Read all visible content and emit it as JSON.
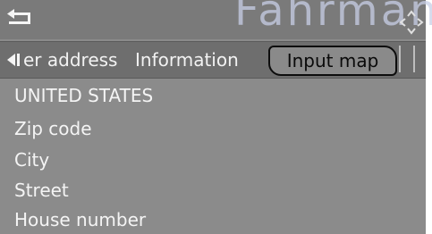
{
  "watermark": "Fahrmanual",
  "tabs": {
    "previous_label": "er address",
    "info_label": "Information",
    "active_label": "Input map"
  },
  "list": {
    "items": [
      {
        "label": "UNITED STATES"
      },
      {
        "label": "Zip code"
      },
      {
        "label": "City"
      },
      {
        "label": "Street"
      },
      {
        "label": "House number"
      }
    ]
  },
  "icons": {
    "back": "back-arrow-icon",
    "joystick": "controller-joystick-icon",
    "tab_left": "tab-scroll-left-icon"
  }
}
